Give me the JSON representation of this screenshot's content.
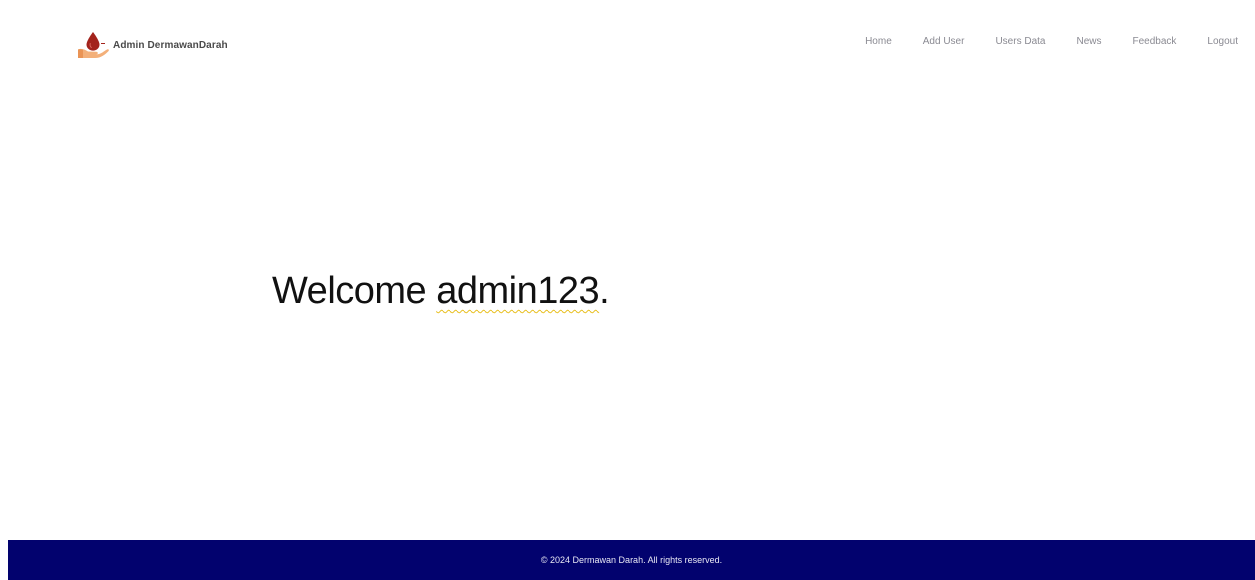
{
  "navbar": {
    "brand": {
      "name": "Admin DermawanDarah",
      "logo_icon": "blood-drop-hand-icon"
    },
    "links": [
      {
        "label": "Home"
      },
      {
        "label": "Add User"
      },
      {
        "label": "Users Data"
      },
      {
        "label": "News"
      },
      {
        "label": "Feedback"
      },
      {
        "label": "Logout"
      }
    ]
  },
  "main": {
    "welcome_prefix": "Welcome ",
    "username": "admin123",
    "welcome_suffix": "."
  },
  "footer": {
    "text": "© 2024 Dermawan Darah. All rights reserved."
  },
  "colors": {
    "footer_bg": "#02026e",
    "nav_link": "#8a8a92",
    "brand_drop": "#a3231c",
    "brand_hand": "#f3b07a",
    "username_underline": "#e8c020"
  }
}
